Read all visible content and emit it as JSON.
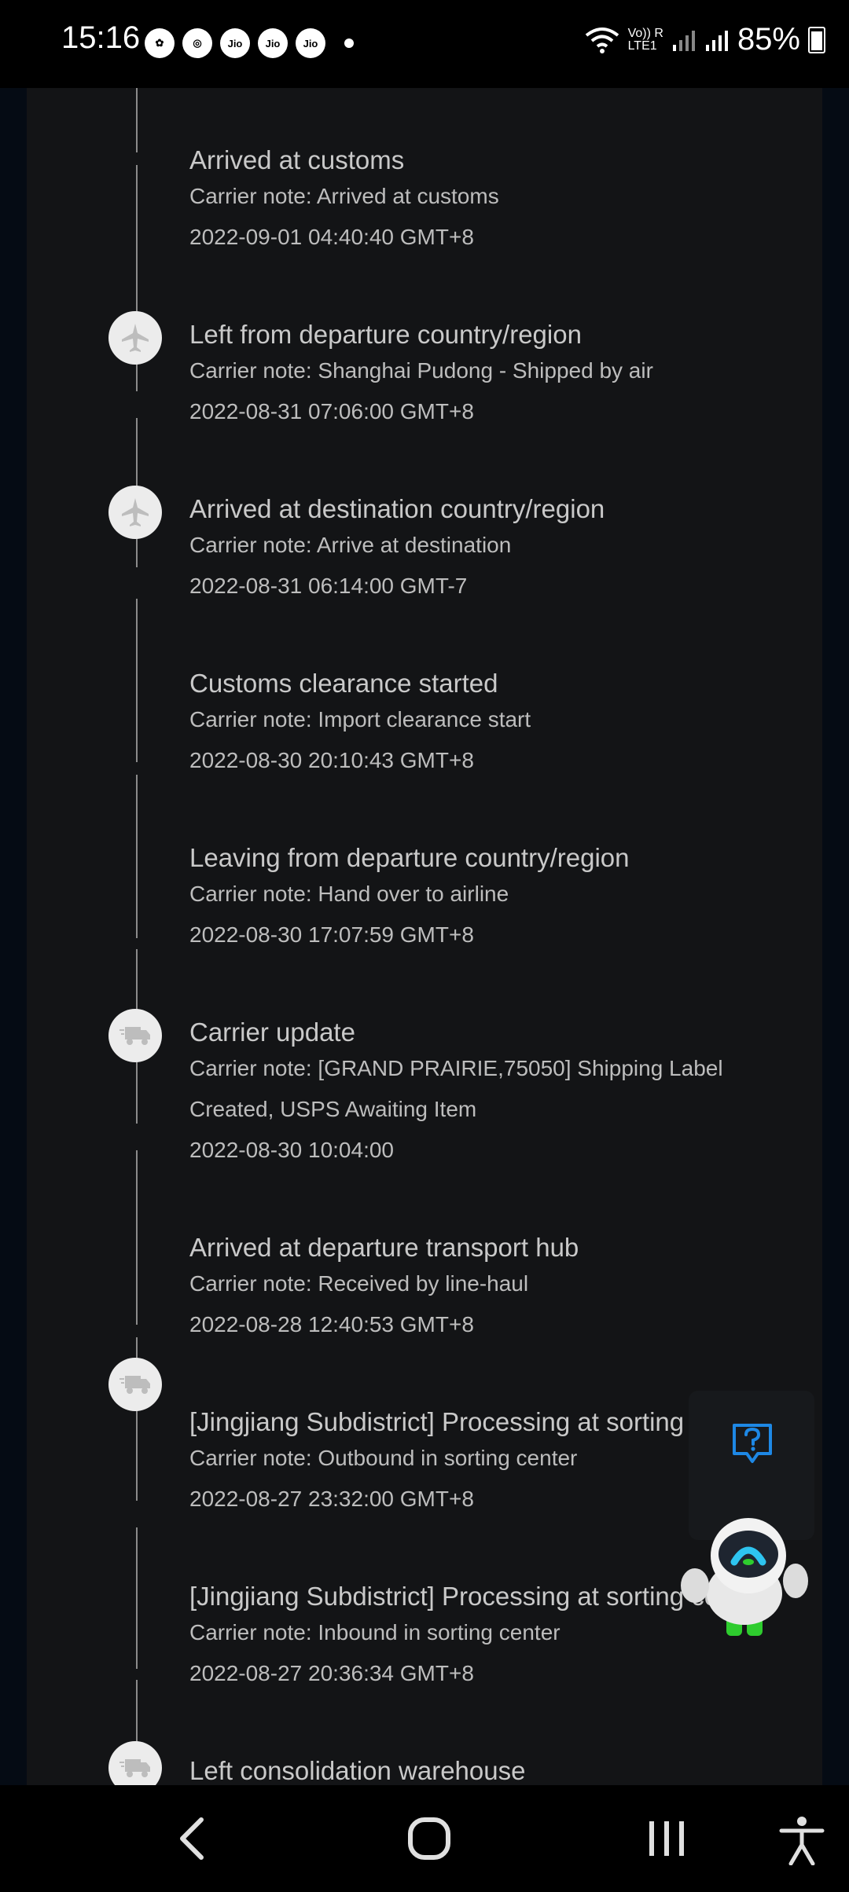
{
  "status": {
    "time": "15:16",
    "left_icons": [
      "",
      "Jio",
      "Jio",
      "Jio"
    ],
    "net_top": "Vo)) R",
    "net_bottom": "LTE1",
    "battery": "85%"
  },
  "events": [
    {
      "title": "Arrived at customs",
      "note": "Carrier note: Arrived at customs",
      "time": "2022-09-01 04:40:40 GMT+8",
      "icon": "none"
    },
    {
      "title": "Left from departure country/region",
      "note": "Carrier note: Shanghai Pudong - Shipped by air",
      "time": "2022-08-31 07:06:00 GMT+8",
      "icon": "airplane-icon"
    },
    {
      "title": "Arrived at destination country/region",
      "note": "Carrier note: Arrive at destination",
      "time": "2022-08-31 06:14:00 GMT-7",
      "icon": "airplane-icon"
    },
    {
      "title": "Customs clearance started",
      "note": "Carrier note: Import clearance start",
      "time": "2022-08-30 20:10:43 GMT+8",
      "icon": "none"
    },
    {
      "title": "Leaving from departure country/region",
      "note": "Carrier note: Hand over to airline",
      "time": "2022-08-30 17:07:59 GMT+8",
      "icon": "none"
    },
    {
      "title": "Carrier update",
      "note": "Carrier note: [GRAND PRAIRIE,75050] Shipping Label",
      "note2": "Created, USPS Awaiting Item",
      "time": "2022-08-30 10:04:00",
      "icon": "truck-icon"
    },
    {
      "title": "Arrived at departure transport hub",
      "note": "Carrier note: Received by line-haul",
      "time": "2022-08-28 12:40:53 GMT+8",
      "icon": "none"
    },
    {
      "title": "[Jingjiang Subdistrict] Processing at sorting center",
      "note": "Carrier note: Outbound in sorting center",
      "time": "2022-08-27 23:32:00 GMT+8",
      "icon": "truck-icon"
    },
    {
      "title": "[Jingjiang Subdistrict] Processing at sorting center",
      "note": "Carrier note: Inbound in sorting center",
      "time": "2022-08-27 20:36:34 GMT+8",
      "icon": "none"
    },
    {
      "title": "Left consolidation warehouse",
      "icon": "truck-icon"
    }
  ],
  "colors": {
    "panel": "#131416",
    "frame": "#050b14",
    "help_blue": "#1e88e5"
  }
}
